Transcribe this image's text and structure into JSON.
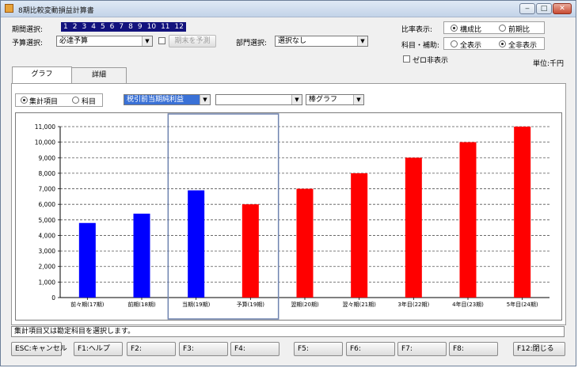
{
  "window": {
    "title": "8期比較変動損益計算書",
    "min": "‒",
    "max": "□",
    "close": "✕"
  },
  "header": {
    "period_label": "期間選択:",
    "period_items": [
      "1",
      "2",
      "3",
      "4",
      "5",
      "6",
      "7",
      "8",
      "9",
      "10",
      "11",
      "12"
    ],
    "budget_label": "予算選択:",
    "budget_value": "必達予算",
    "forecast_button": "期末を予測",
    "dept_label": "部門選択:",
    "dept_value": "選択なし",
    "ratio_label": "比率表示:",
    "ratio_options": [
      "構成比",
      "前期比"
    ],
    "subject_label": "科目・補助:",
    "subject_options": [
      "全表示",
      "全非表示"
    ],
    "zero_hide_label": "ゼロ非表示",
    "unit_label": "単位:千円"
  },
  "tabs": [
    "グラフ",
    "詳細"
  ],
  "graph_panel": {
    "aggregate_options": [
      "集計項目",
      "科目"
    ],
    "item_value": "税引前当期純利益",
    "second_value": "",
    "chart_type_value": "棒グラフ"
  },
  "chart_data": {
    "type": "bar",
    "categories": [
      "前々期(17期)",
      "前期(18期)",
      "当期(19期)",
      "予算(19期)",
      "翌期(20期)",
      "翌々期(21期)",
      "3年目(22期)",
      "4年目(23期)",
      "5年目(24期)"
    ],
    "values": [
      4800,
      5400,
      6900,
      6000,
      7000,
      8000,
      9000,
      10000,
      11000
    ],
    "colors": [
      "#0000ff",
      "#0000ff",
      "#0000ff",
      "#ff0000",
      "#ff0000",
      "#ff0000",
      "#ff0000",
      "#ff0000",
      "#ff0000"
    ],
    "ylim": [
      0,
      11000
    ],
    "yticks": [
      "0",
      "1,000",
      "2,000",
      "3,000",
      "4,000",
      "5,000",
      "6,000",
      "7,000",
      "8,000",
      "9,000",
      "10,000",
      "11,000"
    ],
    "grid": true,
    "highlight_color": "#6f83b0"
  },
  "status_text": "集計項目又は勘定科目を選択します。",
  "footer": [
    "ESC:キャンセル",
    "F1:ヘルプ",
    "F2:",
    "F3:",
    "F4:",
    "F5:",
    "F6:",
    "F7:",
    "F8:",
    "F12:閉じる"
  ]
}
